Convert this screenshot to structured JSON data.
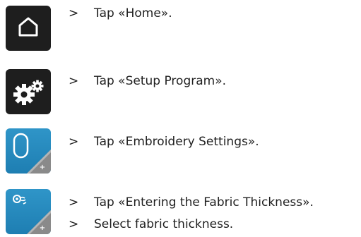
{
  "steps": [
    {
      "icon": "home-icon",
      "text": "Tap «Home»."
    },
    {
      "icon": "setup-gears-icon",
      "text": "Tap «Setup Program»."
    },
    {
      "icon": "embroidery-hoop-icon",
      "text": "Tap «Embroidery Settings»."
    },
    {
      "icon": "fabric-thickness-icon",
      "text": "Tap «Entering the Fabric Thickness»."
    },
    {
      "icon": null,
      "text": "Select fabric thickness."
    }
  ],
  "bullet": ">",
  "colors": {
    "dark_tile": "#1e1e1e",
    "blue_tile": "#2383b9",
    "gray_corner": "#8a8a8a",
    "text": "#1f1f1f"
  }
}
